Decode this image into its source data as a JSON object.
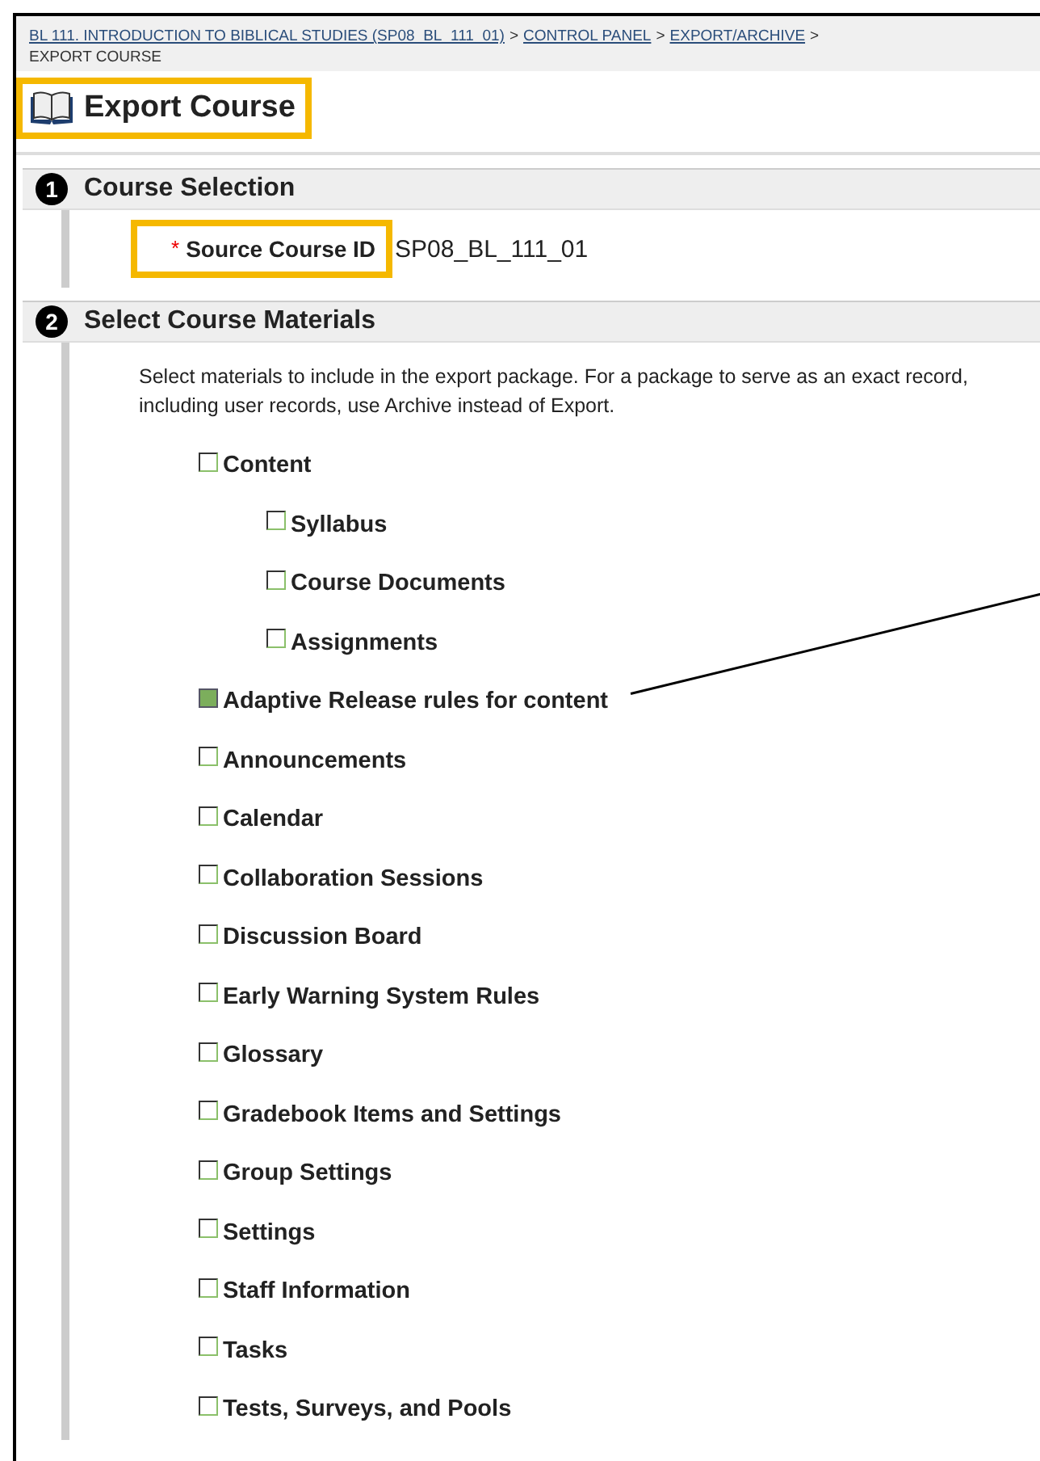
{
  "breadcrumb": {
    "links": [
      "BL 111. INTRODUCTION TO BIBLICAL STUDIES (SP08_BL_111_01)",
      "CONTROL PANEL",
      "EXPORT/ARCHIVE"
    ],
    "separator": ">",
    "current": "EXPORT COURSE"
  },
  "page_title": {
    "text": "Export Course",
    "highlighted": true
  },
  "sections": [
    {
      "number": "1",
      "title": "Course Selection",
      "field": {
        "required_mark": "*",
        "label": "Source Course ID",
        "value": "SP08_BL_111_01",
        "highlighted": true
      }
    },
    {
      "number": "2",
      "title": "Select Course Materials",
      "description": "Select materials to include in the export package. For a package to serve as an exact record, including user records, use Archive instead of Export.",
      "materials": [
        {
          "label": "Content",
          "checked": false,
          "disabled": false,
          "children": [
            {
              "label": "Syllabus",
              "checked": false,
              "disabled": false
            },
            {
              "label": "Course Documents",
              "checked": false,
              "disabled": false
            },
            {
              "label": "Assignments",
              "checked": false,
              "disabled": false
            }
          ]
        },
        {
          "label": "Adaptive Release rules for content",
          "checked": false,
          "disabled": true,
          "callout": true
        },
        {
          "label": "Announcements",
          "checked": false,
          "disabled": false
        },
        {
          "label": "Calendar",
          "checked": false,
          "disabled": false
        },
        {
          "label": "Collaboration Sessions",
          "checked": false,
          "disabled": false
        },
        {
          "label": "Discussion Board",
          "checked": false,
          "disabled": false
        },
        {
          "label": "Early Warning System Rules",
          "checked": false,
          "disabled": false
        },
        {
          "label": "Glossary",
          "checked": false,
          "disabled": false
        },
        {
          "label": "Gradebook Items and Settings",
          "checked": false,
          "disabled": false
        },
        {
          "label": "Group Settings",
          "checked": false,
          "disabled": false
        },
        {
          "label": "Settings",
          "checked": false,
          "disabled": false
        },
        {
          "label": "Staff Information",
          "checked": false,
          "disabled": false
        },
        {
          "label": "Tasks",
          "checked": false,
          "disabled": false
        },
        {
          "label": "Tests, Surveys, and Pools",
          "checked": false,
          "disabled": false
        }
      ]
    }
  ]
}
